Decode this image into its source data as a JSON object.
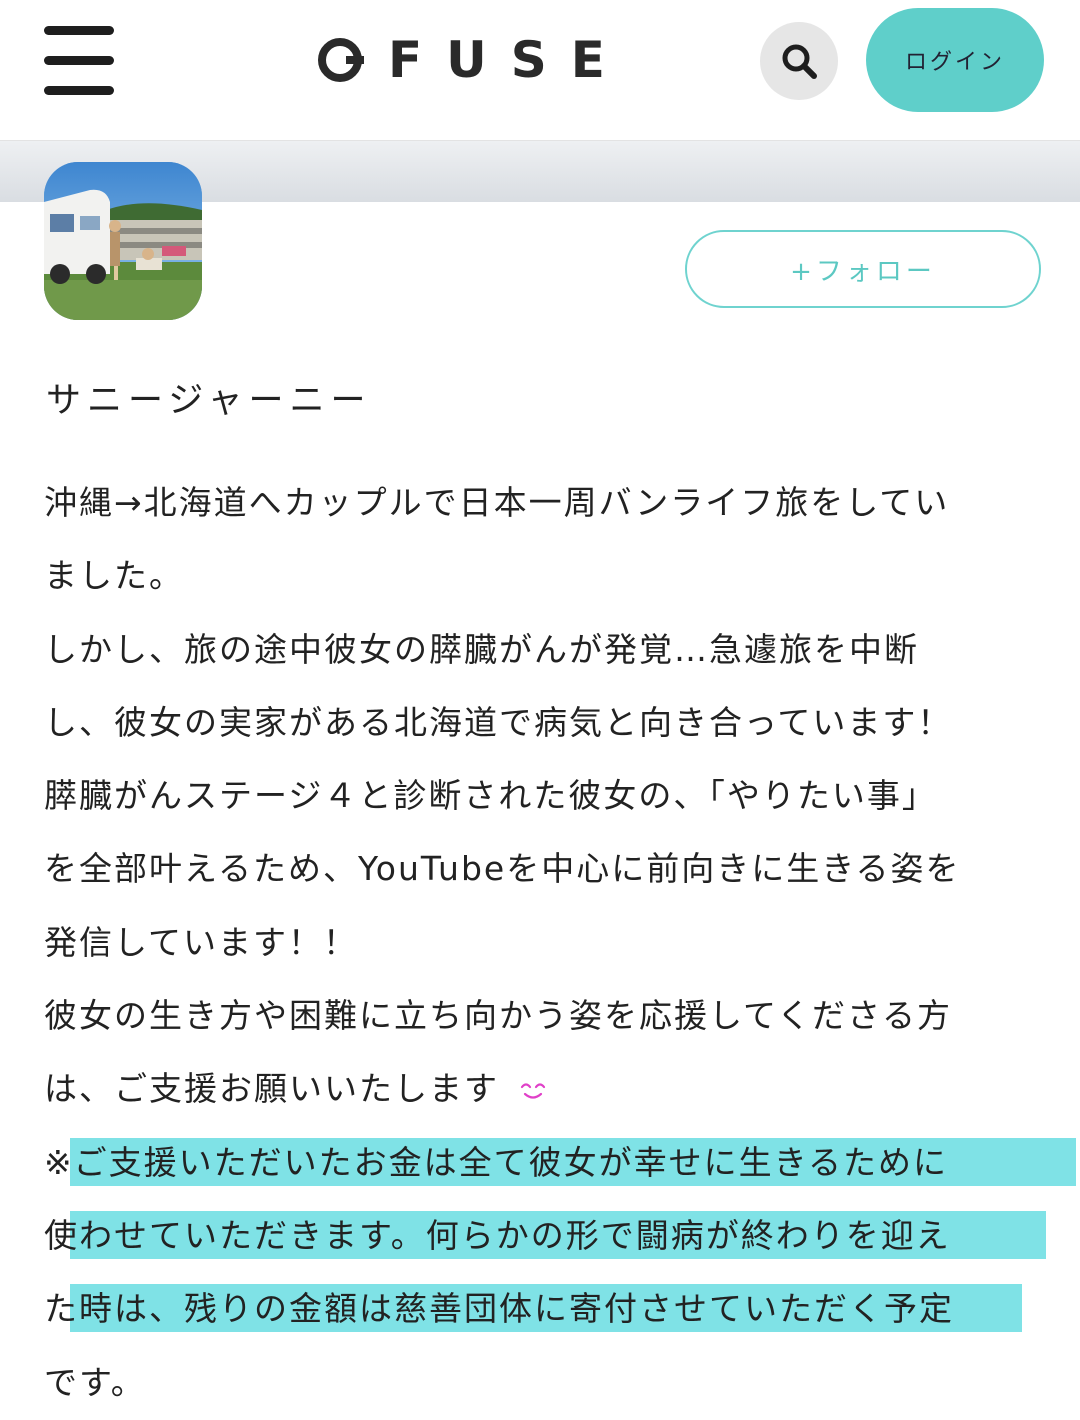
{
  "header": {
    "logo_text": "FUSE",
    "login_label": "ログイン"
  },
  "profile": {
    "follow_label": "+フォロー",
    "name": "サニージャーニー"
  },
  "bio": {
    "lines": [
      "沖縄→北海道へカップルで日本一周バンライフ旅をしてい",
      "ました。",
      "しかし、旅の途中彼女の膵臓がんが発覚…急遽旅を中断",
      "し、彼女の実家がある北海道で病気と向き合っています！",
      "膵臓がんステージ４と診断された彼女の、「やりたい事」",
      "を全部叶えるため、YouTubeを中心に前向きに生きる姿を",
      "発信しています！！",
      "彼女の生き方や困難に立ち向かう姿を応援してくださる方",
      "は、ご支援お願いいたします",
      "※ご支援いただいたお金は全て彼女が幸せに生きるために",
      "使わせていただきます。何らかの形で闘病が終わりを迎え",
      "た時は、残りの金額は慈善団体に寄付させていただく予定",
      "です。"
    ]
  },
  "colors": {
    "accent": "#5fcfca",
    "highlight": "#7fe2e6",
    "emoji": "#e040c8"
  },
  "icons": {
    "menu": "hamburger-icon",
    "search": "search-icon",
    "logo": "o-circle-icon",
    "emoji": "smiling-face-icon"
  }
}
